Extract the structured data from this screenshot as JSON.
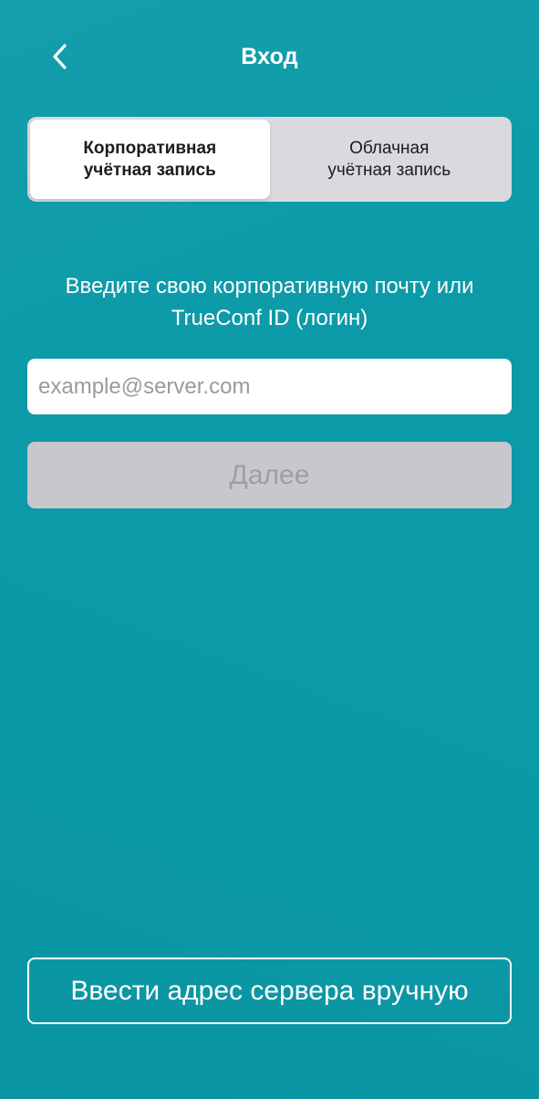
{
  "header": {
    "title": "Вход",
    "back_icon": "chevron-left-icon"
  },
  "account_type": {
    "tabs": [
      {
        "line1": "Корпоративная",
        "line2": "учётная запись",
        "selected": true
      },
      {
        "line1": "Облачная",
        "line2": "учётная запись",
        "selected": false
      }
    ]
  },
  "login": {
    "prompt_line1": "Введите свою корпоративную почту или",
    "prompt_line2": "TrueConf ID (логин)",
    "email_placeholder": "example@server.com",
    "email_value": "",
    "next_label": "Далее",
    "next_enabled": false
  },
  "footer": {
    "manual_server_label": "Ввести адрес сервера вручную"
  },
  "colors": {
    "background": "#0b9aa8",
    "segment_bg": "#d9d9de",
    "disabled_button": "#c7c7cc",
    "text_light": "#ffffff"
  }
}
